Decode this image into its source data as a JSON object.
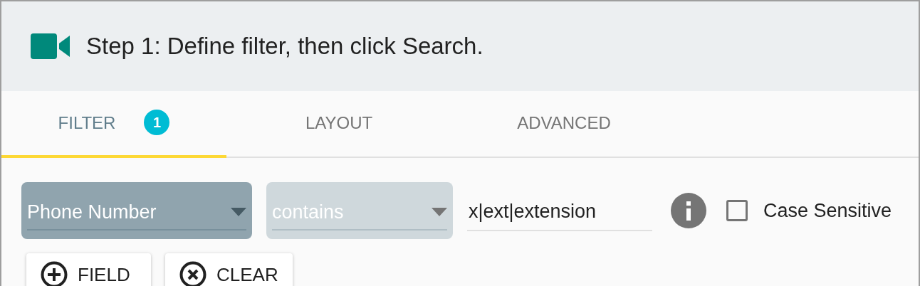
{
  "header": {
    "title": "Step 1: Define filter, then click Search."
  },
  "tabs": [
    {
      "label": "FILTER",
      "selected": true,
      "badge": "1"
    },
    {
      "label": "LAYOUT",
      "selected": false
    },
    {
      "label": "ADVANCED",
      "selected": false
    }
  ],
  "filter_row": {
    "selects": [
      {
        "value": "Phone Number",
        "disabled": false
      },
      {
        "value": "contains",
        "disabled": true
      }
    ],
    "text_field": {
      "value": "x|ext|extension"
    },
    "case_sensitive": {
      "label": "Case Sensitive",
      "checked": false
    }
  },
  "buttons": [
    {
      "kind": "add",
      "label": "FIELD"
    },
    {
      "kind": "clear",
      "label": "CLEAR"
    }
  ]
}
